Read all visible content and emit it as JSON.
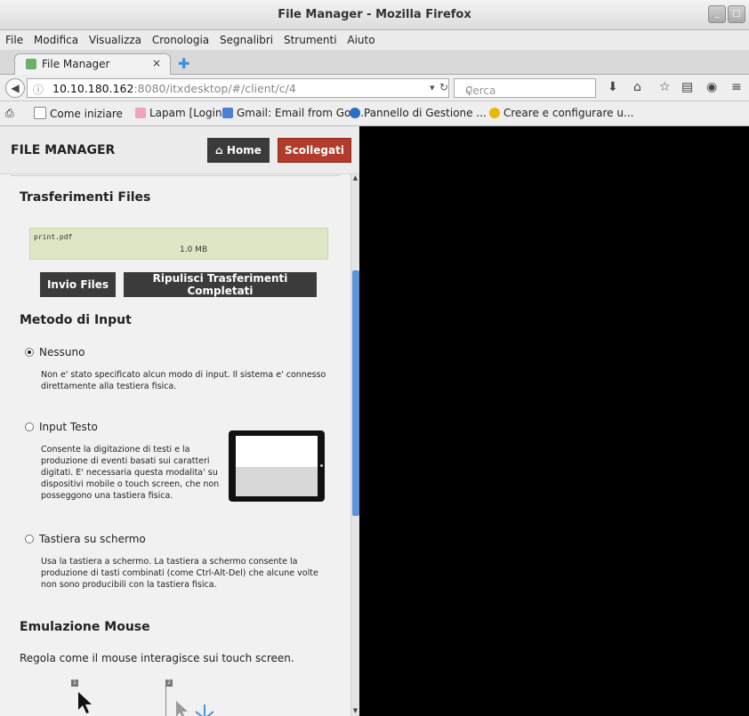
{
  "window": {
    "title": "File Manager - Mozilla Firefox",
    "minimize": "_",
    "maximize": "□"
  },
  "menu": [
    "File",
    "Modifica",
    "Visualizza",
    "Cronologia",
    "Segnalibri",
    "Strumenti",
    "Aiuto"
  ],
  "tab": {
    "label": "File Manager",
    "close": "×",
    "new_tab": "✚"
  },
  "nav": {
    "url_host": "10.10.180.162",
    "url_rest": ":8080/itxdesktop/#/client/c/4",
    "search_placeholder": "Cerca"
  },
  "bookmarks": [
    "Come iniziare",
    "Lapam [Login]",
    "Gmail: Email from Goo...",
    "Pannello di Gestione ...",
    "Creare e configurare u..."
  ],
  "app": {
    "title": "FILE MANAGER",
    "home_label": "Home",
    "logout_label": "Scollegati",
    "transfers": {
      "heading": "Trasferimenti Files",
      "file_name": "print.pdf",
      "file_size": "1.0 MB",
      "send_label": "Invio Files",
      "clear_label": "Ripulisci Trasferimenti Completati"
    },
    "input_method": {
      "heading": "Metodo di Input",
      "options": [
        {
          "label": "Nessuno",
          "selected": true,
          "desc_lines": [
            "Non e' stato specificato alcun modo di input. Il sistema e' connesso",
            "direttamente alla testiera fisica."
          ]
        },
        {
          "label": "Input Testo",
          "selected": false,
          "desc_lines": [
            "Consente la digitazione di testi e la",
            "produzione di eventi basati sui caratteri",
            "digitati. E' necessaria questa modalita' su",
            "dispositivi mobile o touch screen, che non",
            "posseggono una tastiera fisica."
          ]
        },
        {
          "label": "Tastiera su schermo",
          "selected": false,
          "desc_lines": [
            "Usa la tastiera a schermo. La tastiera a schermo consente la",
            "produzione di tasti combinati (come Ctrl-Alt-Del) che alcune volte",
            "non sono producibili con la tastiera fisica."
          ]
        }
      ]
    },
    "mouse": {
      "heading": "Emulazione Mouse",
      "desc": "Regola come il mouse interagisce sui touch screen.",
      "mode1_badge": "1",
      "mode2_badge": "2"
    }
  },
  "colors": {
    "logout": "#b23b2b",
    "dark_button": "#3b3b3b",
    "scroll_thumb": "#5d93d7",
    "transfer_bg": "#dde7c6"
  }
}
